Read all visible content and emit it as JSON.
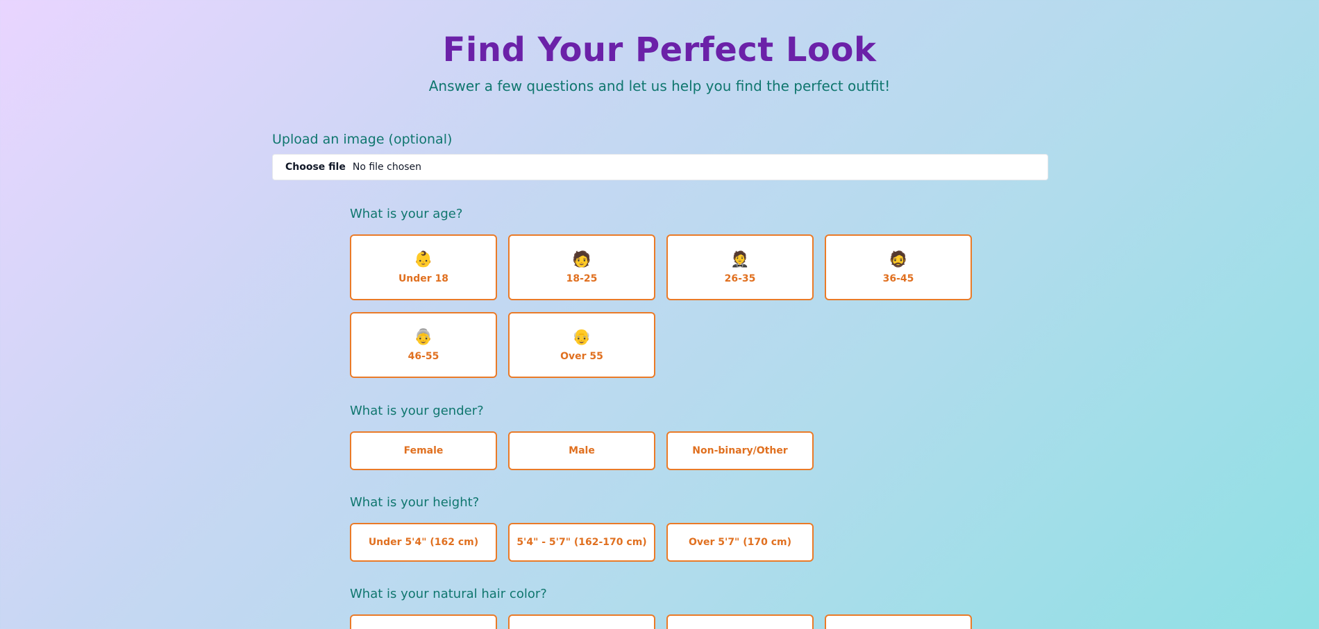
{
  "header": {
    "title": "Find Your Perfect Look",
    "subtitle": "Answer a few questions and let us help you find the perfect outfit!"
  },
  "upload": {
    "label": "Upload an image (optional)",
    "button": "Choose file",
    "status": "No file chosen"
  },
  "questions": {
    "age": {
      "label": "What is your age?",
      "options": [
        {
          "label": "Under 18",
          "emoji": "👶"
        },
        {
          "label": "18-25",
          "emoji": "🧑"
        },
        {
          "label": "26-35",
          "emoji": "🤵"
        },
        {
          "label": "36-45",
          "emoji": "🧔"
        },
        {
          "label": "46-55",
          "emoji": "👵"
        },
        {
          "label": "Over 55",
          "emoji": "👴"
        }
      ]
    },
    "gender": {
      "label": "What is your gender?",
      "options": [
        {
          "label": "Female"
        },
        {
          "label": "Male"
        },
        {
          "label": "Non-binary/Other"
        }
      ]
    },
    "height": {
      "label": "What is your height?",
      "options": [
        {
          "label": "Under 5'4\" (162 cm)"
        },
        {
          "label": "5'4\" - 5'7\" (162-170 cm)"
        },
        {
          "label": "Over 5'7\" (170 cm)"
        }
      ]
    },
    "hair": {
      "label": "What is your natural hair color?"
    }
  },
  "colors": {
    "title": "#6b21a8",
    "accent_text": "#0f766e",
    "option_border": "#ea7a27",
    "option_text": "#e07020"
  }
}
